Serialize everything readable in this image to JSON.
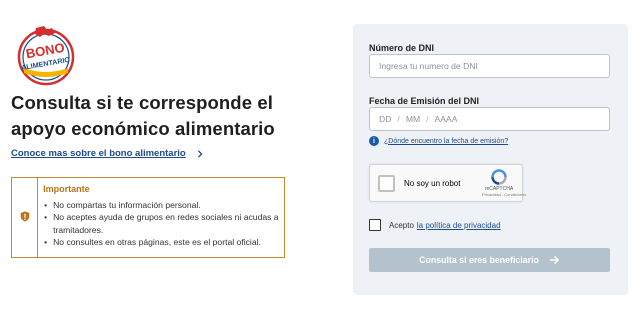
{
  "logo": {
    "line1": "BONO",
    "line2": "ALIMENTARIO",
    "colors": {
      "red": "#d32f2f",
      "blue": "#1c4b8f",
      "gold": "#f4b400"
    }
  },
  "headline": {
    "line1": "Consulta si te corresponde el",
    "line2": "apoyo económico alimentario"
  },
  "more_link": {
    "label": "Conoce mas sobre el bono alimentario",
    "icon": "chevron-right-icon"
  },
  "notice": {
    "title": "Importante",
    "icon": "shield-alert-icon",
    "items": [
      "No compartas tu información personal.",
      "No aceptes ayuda de grupos en redes sociales ni acudas a tramitadores.",
      "No consultes en otras páginas, este es el portal oficial."
    ]
  },
  "form": {
    "dni_label": "Número de DNI",
    "dni_placeholder": "Ingresa tu numero de DNI",
    "date_label": "Fecha de Emisión del DNI",
    "date_dd": "DD",
    "date_mm": "MM",
    "date_yyyy": "AAAA",
    "date_sep": "/",
    "help_link": "¿Dónde encuentro la fecha de emisión?",
    "recaptcha": {
      "label": "No soy un robot",
      "brand": "reCAPTCHA",
      "terms": "Privacidad - Condiciones"
    },
    "privacy_text": "Acepto",
    "privacy_link": "la política de privacidad",
    "submit_label": "Consulta si eres beneficiario"
  },
  "colors": {
    "accent": "#1c4b8f",
    "notice_border": "#c9892a",
    "panel_bg": "#eef2f6",
    "button_disabled": "#b3c2cc"
  }
}
